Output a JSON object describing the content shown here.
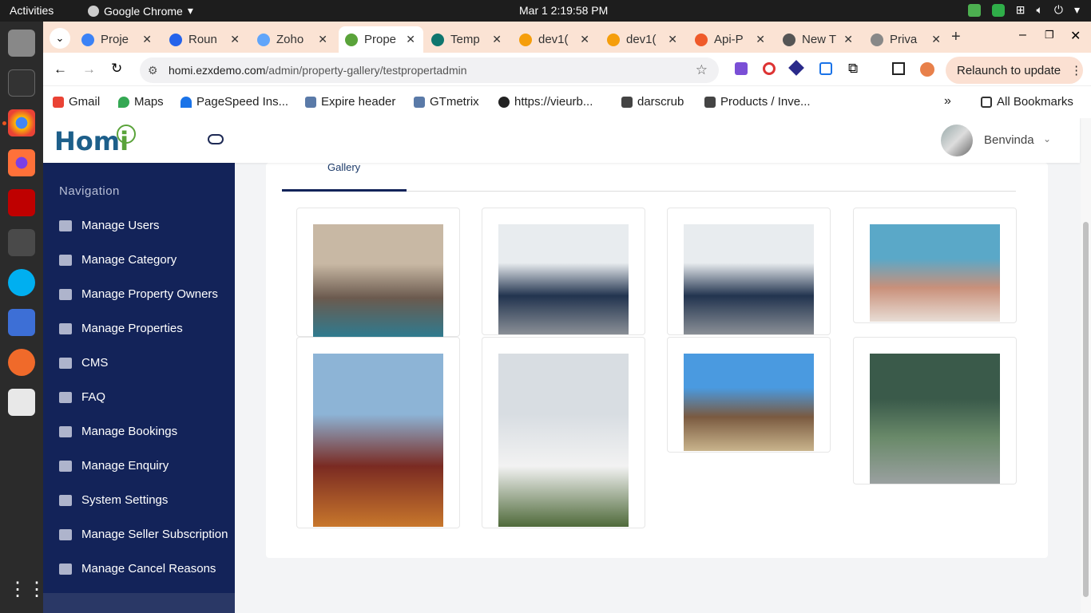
{
  "os": {
    "activities": "Activities",
    "app_name": "Google Chrome",
    "clock": "Mar 1  2:19:58 PM"
  },
  "tabs": [
    {
      "label": "Proje",
      "color": "#3b82f6"
    },
    {
      "label": "Roun",
      "color": "#2563eb"
    },
    {
      "label": "Zoho",
      "color": "#60a5fa"
    },
    {
      "label": "Prope",
      "color": "#5aa33a"
    },
    {
      "label": "Temp",
      "color": "#0f766e"
    },
    {
      "label": "dev1(",
      "color": "#f59e0b"
    },
    {
      "label": "dev1(",
      "color": "#f59e0b"
    },
    {
      "label": "Api-P",
      "color": "#ef5a2a"
    },
    {
      "label": "New T",
      "color": "#555555"
    },
    {
      "label": "Priva",
      "color": "#888888"
    }
  ],
  "address": {
    "host": "homi.ezxdemo.com",
    "path": "/admin/property-gallery/testpropertadmin"
  },
  "relaunch_label": "Relaunch to update",
  "bookmarks": [
    {
      "label": "Gmail"
    },
    {
      "label": "Maps"
    },
    {
      "label": "PageSpeed Ins..."
    },
    {
      "label": "Expire header"
    },
    {
      "label": "GTmetrix"
    },
    {
      "label": "https://vieurb..."
    },
    {
      "label": "darscrub"
    },
    {
      "label": "Products / Inve..."
    }
  ],
  "all_bookmarks": "All Bookmarks",
  "header": {
    "logo_text": "Hom",
    "user_name": "Benvinda"
  },
  "sidebar": {
    "title": "Navigation",
    "items": [
      {
        "label": "Manage Users",
        "icon": "users-icon"
      },
      {
        "label": "Manage Category",
        "icon": "category-icon"
      },
      {
        "label": "Manage Property Owners",
        "icon": "owners-icon"
      },
      {
        "label": "Manage Properties",
        "icon": "building-icon"
      },
      {
        "label": "CMS",
        "icon": "file-icon"
      },
      {
        "label": "FAQ",
        "icon": "file-icon"
      },
      {
        "label": "Manage Bookings",
        "icon": "book-icon"
      },
      {
        "label": "Manage Enquiry",
        "icon": "book-icon"
      },
      {
        "label": "System Settings",
        "icon": "file-icon"
      },
      {
        "label": "Manage Seller Subscription",
        "icon": "file-icon"
      },
      {
        "label": "Manage Cancel Reasons",
        "icon": "card-icon"
      }
    ]
  },
  "gallery": {
    "tab_label": "Gallery",
    "images": [
      {
        "alt": "living-room",
        "colors": [
          "#c8b8a4",
          "#6b5a4e",
          "#2e7b90"
        ]
      },
      {
        "alt": "dining-room-1",
        "colors": [
          "#e8ecef",
          "#22344f",
          "#8a8f96"
        ]
      },
      {
        "alt": "dining-room-2",
        "colors": [
          "#e8ecef",
          "#22344f",
          "#8a8f96"
        ]
      },
      {
        "alt": "apartment-building",
        "colors": [
          "#5aa8c8",
          "#c9907a",
          "#e8ddd5"
        ]
      },
      {
        "alt": "red-barn-house",
        "colors": [
          "#8db4d6",
          "#7a2a22",
          "#c8772c"
        ]
      },
      {
        "alt": "white-modern-house",
        "colors": [
          "#d8dde2",
          "#f2f2f2",
          "#4f6a3a"
        ]
      },
      {
        "alt": "brown-suburban-house",
        "colors": [
          "#4a9ae0",
          "#7a5a40",
          "#c9b48c"
        ]
      },
      {
        "alt": "aerial-view",
        "colors": [
          "#3a5a4a",
          "#6a8a6a",
          "#9aa0a0"
        ]
      }
    ]
  }
}
